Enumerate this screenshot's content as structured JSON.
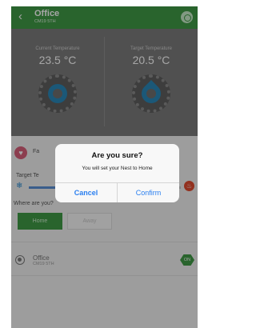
{
  "header": {
    "title": "Office",
    "subtitle": "CM19 5TH"
  },
  "temps": {
    "current_label": "Current Temperature",
    "current_value": "23.5 °C",
    "target_label": "Target Temperature",
    "target_value": "20.5 °C"
  },
  "controls": {
    "favourite_label": "Fa",
    "target_label": "Target Te",
    "where_label": "Where are you?",
    "home_label": "Home",
    "away_label": "Away"
  },
  "device": {
    "name": "Office",
    "postcode": "CM19 5TH",
    "status": "ON"
  },
  "dialog": {
    "title": "Are you sure?",
    "message": "You will set your Nest to Home",
    "cancel_label": "Cancel",
    "confirm_label": "Confirm"
  },
  "colors": {
    "header": "#3f9a45",
    "panel": "#7c7c7c",
    "accent_blue": "#2a7ff0",
    "heat": "#e04a2f",
    "cool": "#2c8ad0"
  },
  "icons": [
    "back-chevron-icon",
    "power-icon",
    "heart-icon",
    "snowflake-icon",
    "flame-icon",
    "thermostat-icon"
  ]
}
